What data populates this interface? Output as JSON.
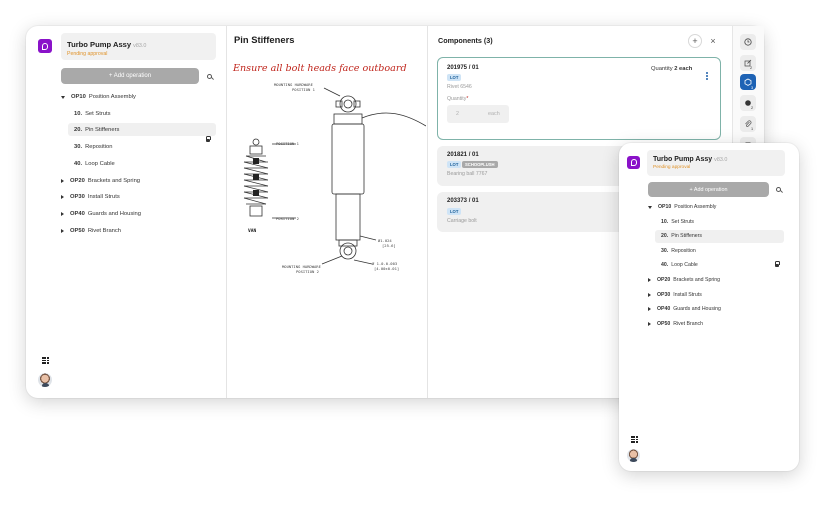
{
  "project": {
    "title": "Turbo Pump Assy",
    "version": "v83.0",
    "status": "Pending approval"
  },
  "sidebar": {
    "add_operation_label": "+ Add operation",
    "tree": [
      {
        "num": "OP10",
        "label": "Position Assembly",
        "expanded": true
      },
      {
        "num": "10",
        "label": "Set Struts"
      },
      {
        "num": "20",
        "label": "Pin Stiffeners",
        "selected": true,
        "locked": true
      },
      {
        "num": "30",
        "label": "Reposition"
      },
      {
        "num": "40",
        "label": "Loop Cable"
      },
      {
        "num": "OP20",
        "label": "Brackets and Spring"
      },
      {
        "num": "OP30",
        "label": "Install Struts"
      },
      {
        "num": "OP40",
        "label": "Guards and Housing"
      },
      {
        "num": "OP50",
        "label": "Rivet Branch"
      }
    ]
  },
  "step": {
    "title": "Pin Stiffeners",
    "note": "Ensure all bolt heads face outboard"
  },
  "drawing": {
    "labels": {
      "mount_top": "MOUNTING HARDWARE",
      "mount_top_pos": "POSITION 1",
      "pos1": "POSITION 1",
      "pos2": "POSITION 2",
      "van": "VAN",
      "dim1a": "Ø1.024",
      "dim1b": "[25.6]",
      "dim2a": "Ø 1.0-0.003",
      "dim2b": "[4.00±0.01]",
      "mount_bottom": "MOUNTING HARDWARE",
      "mount_bottom_pos": "POSITION 2"
    }
  },
  "components": {
    "header": "Components (3)",
    "add_label": "+",
    "close_label": "×",
    "quantity_field_label": "Quantity",
    "quantity_required_mark": "*",
    "quantity_field_value": "2",
    "quantity_field_unit": "each",
    "items": [
      {
        "id": "201975 / 01",
        "badges": [
          "LOT"
        ],
        "name": "Rivet 6546",
        "quantity_prefix": "Quantity",
        "quantity": "2 each"
      },
      {
        "id": "201821 / 01",
        "badges": [
          "LOT",
          "SCHOOPLUSH"
        ],
        "name": "Bearing ball 7767"
      },
      {
        "id": "203373 / 01",
        "badges": [
          "LOT"
        ],
        "name": "Carriage bolt"
      }
    ]
  },
  "rail": {
    "badges": [
      "2",
      "3",
      "2",
      "1"
    ]
  },
  "colors": {
    "brand": "#8a12c9",
    "accent": "#1e63b5",
    "warning_text": "#c0261d",
    "status": "#e0932a"
  }
}
